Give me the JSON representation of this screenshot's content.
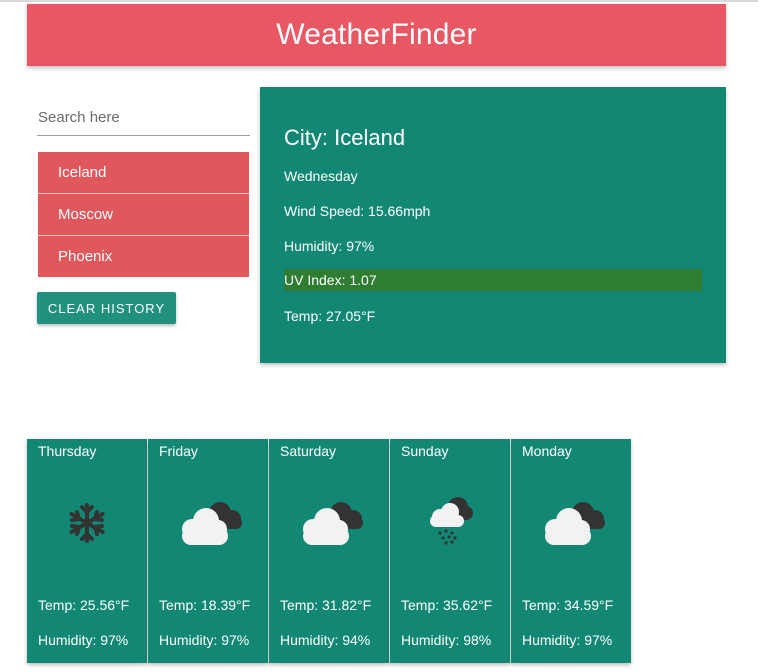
{
  "app": {
    "title": "WeatherFinder"
  },
  "search": {
    "placeholder": "Search here",
    "value": ""
  },
  "history": {
    "items": [
      "Iceland",
      "Moscow",
      "Phoenix"
    ],
    "clear_label": "CLEAR HISTORY"
  },
  "current": {
    "city": "City: Iceland",
    "day": "Wednesday",
    "wind": "Wind Speed: 15.66mph",
    "humidity": "Humidity: 97%",
    "uv": "UV Index: 1.07",
    "temp": "Temp: 27.05°F"
  },
  "forecast": [
    {
      "day": "Thursday",
      "icon": "snow-icon",
      "temp": "Temp: 25.56°F",
      "humidity": "Humidity: 97%"
    },
    {
      "day": "Friday",
      "icon": "cloudy-icon",
      "temp": "Temp: 18.39°F",
      "humidity": "Humidity: 97%"
    },
    {
      "day": "Saturday",
      "icon": "cloudy-icon",
      "temp": "Temp: 31.82°F",
      "humidity": "Humidity: 94%"
    },
    {
      "day": "Sunday",
      "icon": "rain-snow-icon",
      "temp": "Temp: 35.62°F",
      "humidity": "Humidity: 98%"
    },
    {
      "day": "Monday",
      "icon": "cloudy-icon",
      "temp": "Temp: 34.59°F",
      "humidity": "Humidity: 97%"
    }
  ],
  "colors": {
    "header": "#e85764",
    "history_item": "#e0575c",
    "card": "#128874",
    "button": "#21907d",
    "uv_bar": "#2e7d32"
  }
}
